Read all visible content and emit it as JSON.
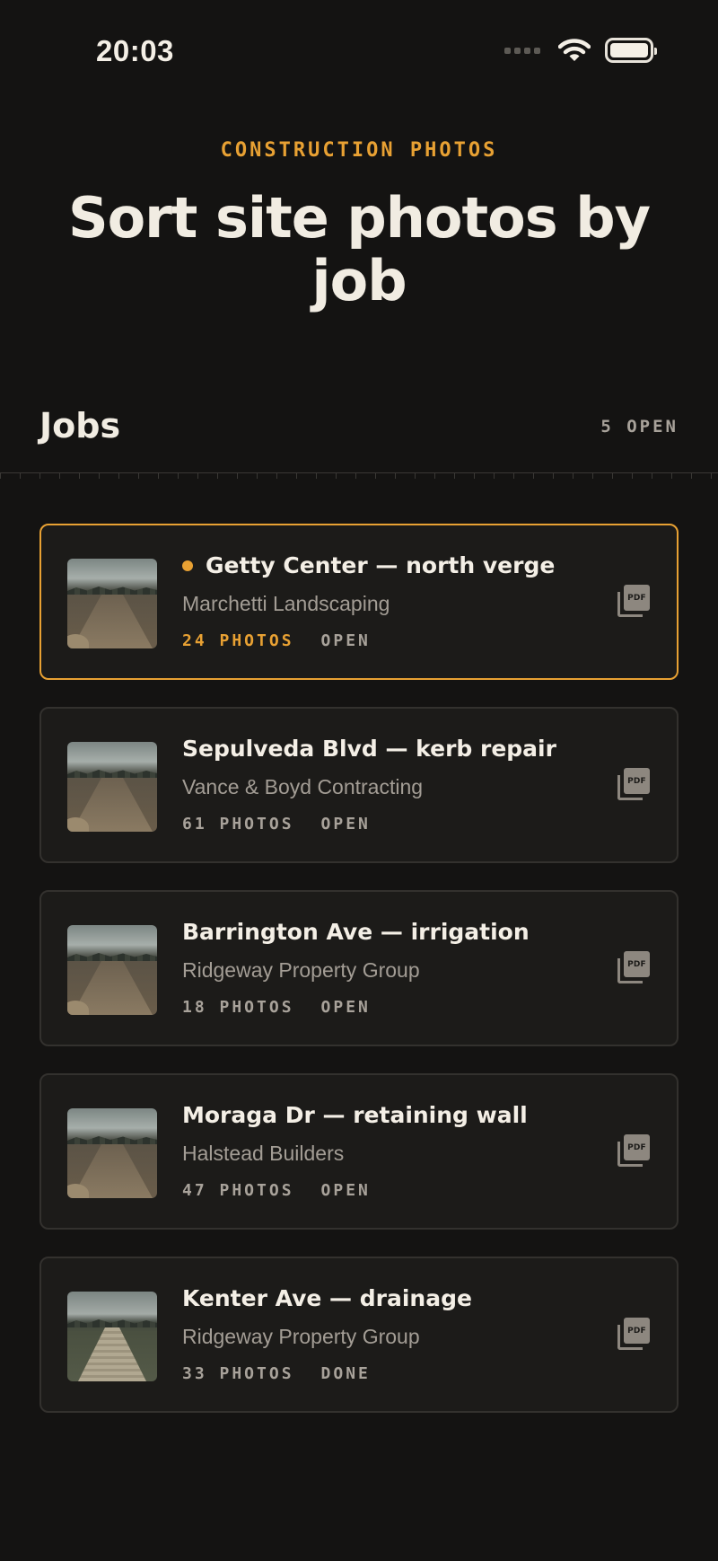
{
  "status_bar": {
    "time": "20:03"
  },
  "header": {
    "eyebrow": "CONSTRUCTION PHOTOS",
    "title": "Sort site photos by job"
  },
  "section": {
    "title": "Jobs",
    "count": "5 OPEN"
  },
  "jobs": [
    {
      "title": "Getty Center — north verge",
      "client": "Marchetti Landscaping",
      "photos": "24 PHOTOS",
      "status": "OPEN",
      "active": true,
      "pdf_label": "PDF"
    },
    {
      "title": "Sepulveda Blvd — kerb repair",
      "client": "Vance & Boyd Contracting",
      "photos": "61 PHOTOS",
      "status": "OPEN",
      "active": false,
      "pdf_label": "PDF"
    },
    {
      "title": "Barrington Ave — irrigation",
      "client": "Ridgeway Property Group",
      "photos": "18 PHOTOS",
      "status": "OPEN",
      "active": false,
      "pdf_label": "PDF"
    },
    {
      "title": "Moraga Dr — retaining wall",
      "client": "Halstead Builders",
      "photos": "47 PHOTOS",
      "status": "OPEN",
      "active": false,
      "pdf_label": "PDF"
    },
    {
      "title": "Kenter Ave — drainage",
      "client": "Ridgeway Property Group",
      "photos": "33 PHOTOS",
      "status": "DONE",
      "active": false,
      "pdf_label": "PDF"
    }
  ],
  "colors": {
    "accent": "#e8a133",
    "background": "#141312",
    "card": "#1c1b19"
  },
  "icons": [
    "wifi-icon",
    "battery-icon",
    "signal-icon",
    "pdf-icon",
    "job-thumbnail"
  ]
}
